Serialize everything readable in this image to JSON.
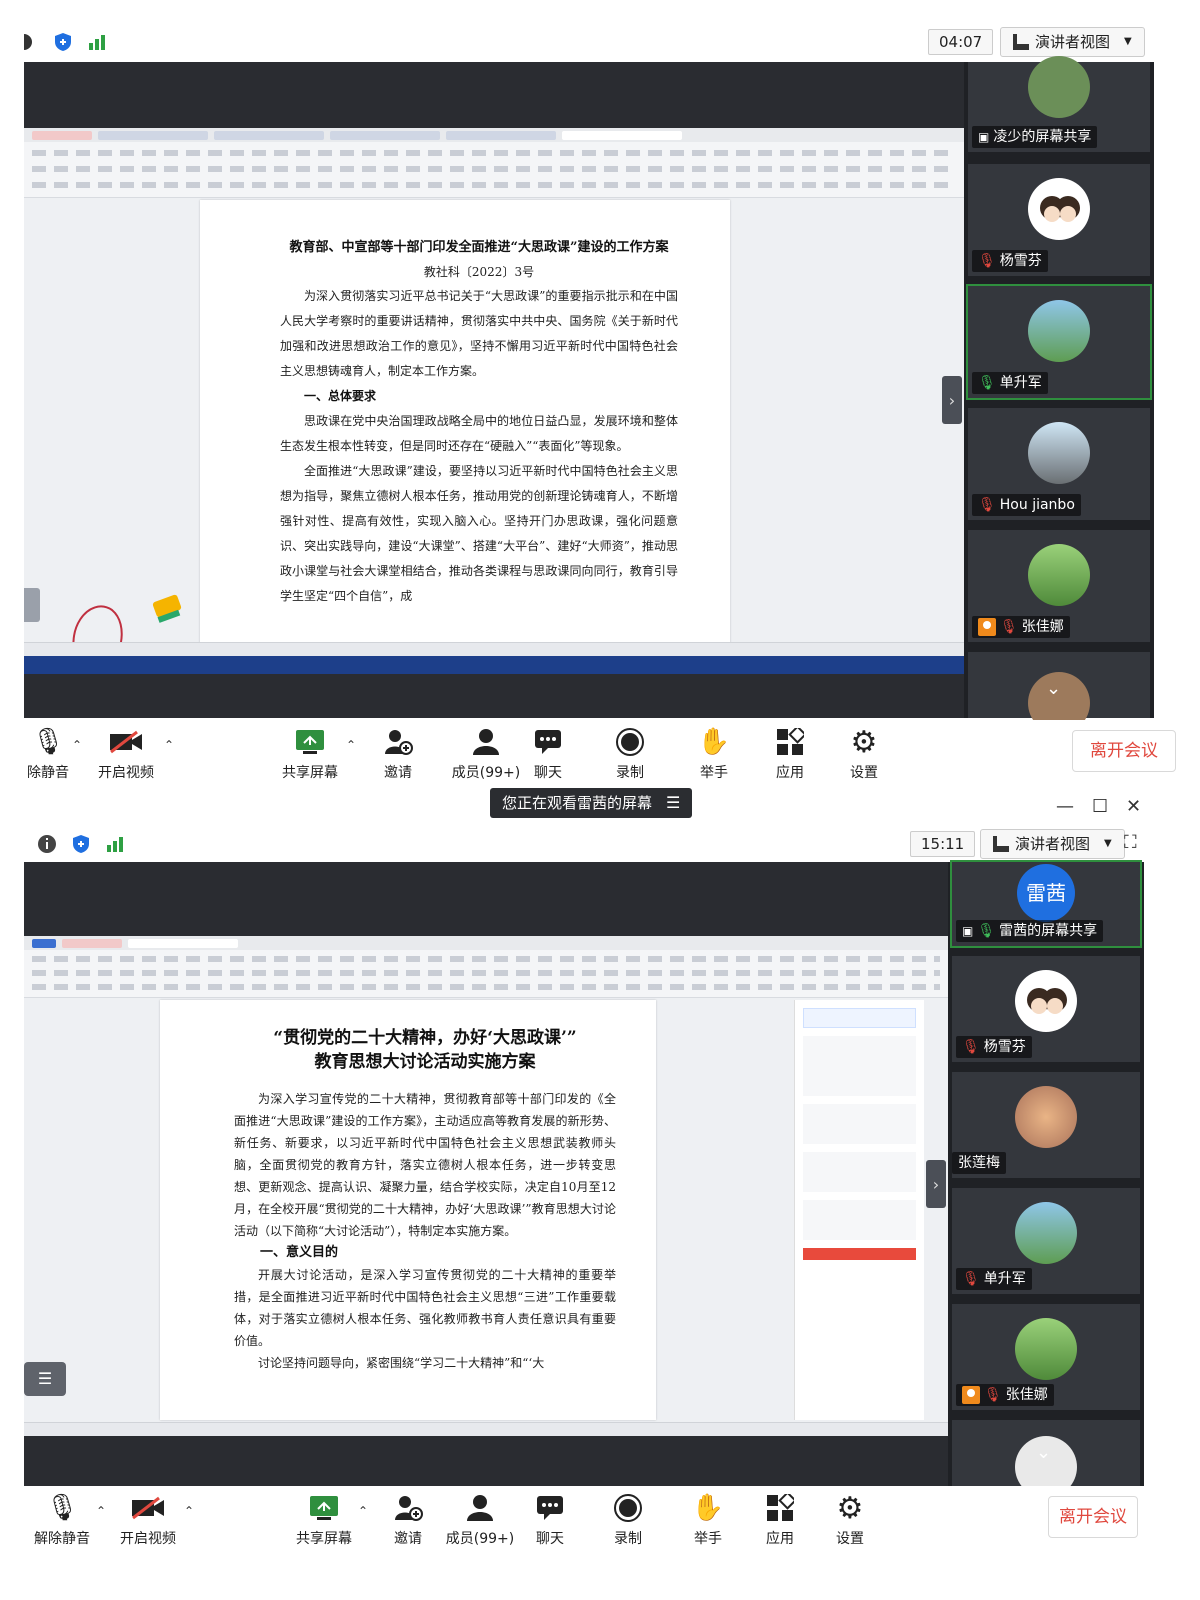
{
  "top_meeting": {
    "timer": "04:07",
    "view_mode": "演讲者视图",
    "document": {
      "title": "教育部、中宣部等十部门印发全面推进“大思政课”建设的工作方案",
      "doc_number": "教社科〔2022〕3号",
      "paragraphs": [
        "为深入贯彻落实习近平总书记关于“大思政课”的重要指示批示和在中国人民大学考察时的重要讲话精神，贯彻落实中共中央、国务院《关于新时代加强和改进思想政治工作的意见》，坚持不懈用习近平新时代中国特色社会主义思想铸魂育人，制定本工作方案。"
      ],
      "heading": "一、总体要求",
      "paragraphs2": [
        "思政课在党中央治国理政战略全局中的地位日益凸显，发展环境和整体生态发生根本性转变，但是同时还存在“硬融入”“表面化”等现象。",
        "全面推进“大思政课”建设，要坚持以习近平新时代中国特色社会主义思想为指导，聚焦立德树人根本任务，推动用党的创新理论铸魂育人，不断增强针对性、提高有效性，实现入脑入心。坚持开门办思政课，强化问题意识、突出实践导向，建设“大课堂”、搭建“大平台”、建好“大师资”，推动思政小课堂与社会大课堂相结合，推动各类课程与思政课同向同行，教育引导学生坚定“四个自信”，成"
      ]
    },
    "participants": [
      {
        "name": "凌少的屏幕共享",
        "kind": "share"
      },
      {
        "name": "杨雪芬",
        "kind": "muted"
      },
      {
        "name": "单升军",
        "kind": "mic",
        "active": true
      },
      {
        "name": "Hou jianbo",
        "kind": "muted"
      },
      {
        "name": "张佳娜",
        "kind": "muted"
      }
    ],
    "toolbar": {
      "mute": "除静音",
      "video": "开启视频",
      "share": "共享屏幕",
      "invite": "邀请",
      "members": "成员(99+)",
      "chat": "聊天",
      "record": "录制",
      "hand": "举手",
      "apps": "应用",
      "settings": "设置",
      "leave": "离开会议"
    }
  },
  "banner": "您正在观看雷茜的屏幕",
  "bottom_meeting": {
    "timer": "15:11",
    "view_mode": "演讲者视图",
    "document": {
      "title_line1": "“贯彻党的二十大精神，办好‘大思政课’”",
      "title_line2": "教育思想大讨论活动实施方案",
      "paragraph": "为深入学习宣传党的二十大精神，贯彻教育部等十部门印发的《全面推进“大思政课”建设的工作方案》，主动适应高等教育发展的新形势、新任务、新要求，以习近平新时代中国特色社会主义思想武装教师头脑，全面贯彻党的教育方针，落实立德树人根本任务，进一步转变思想、更新观念、提高认识、凝聚力量，结合学校实际，决定自10月至12月，在全校开展“贯彻党的二十大精神，办好‘大思政课’”教育思想大讨论活动（以下简称“大讨论活动”），特制定本实施方案。",
      "heading": "一、意义目的",
      "paragraph2": "开展大讨论活动，是深入学习宣传贯彻党的二十大精神的重要举措，是全面推进习近平新时代中国特色社会主义思想“三进”工作重要载体，对于落实立德树人根本任务、强化教师教书育人责任意识具有重要价值。",
      "paragraph3": "讨论坚持问题导向，紧密围绕“学习二十大精神”和“‘大"
    },
    "participants": [
      {
        "name": "雷茜的屏幕共享",
        "kind": "share",
        "active": true,
        "avatar_text": "雷茜"
      },
      {
        "name": "杨雪芬",
        "kind": "muted"
      },
      {
        "name": "张莲梅",
        "kind": "none"
      },
      {
        "name": "单升军",
        "kind": "muted"
      },
      {
        "name": "张佳娜",
        "kind": "muted"
      }
    ],
    "toolbar": {
      "mute": "解除静音",
      "video": "开启视频",
      "share": "共享屏幕",
      "invite": "邀请",
      "members": "成员(99+)",
      "chat": "聊天",
      "record": "录制",
      "hand": "举手",
      "apps": "应用",
      "settings": "设置",
      "leave": "离开会议"
    }
  },
  "colors": {
    "accent_green": "#2f8f3e",
    "leave_red": "#e0483e",
    "stage_dark": "#2a2c31",
    "share_blue": "#1f6fe0"
  }
}
